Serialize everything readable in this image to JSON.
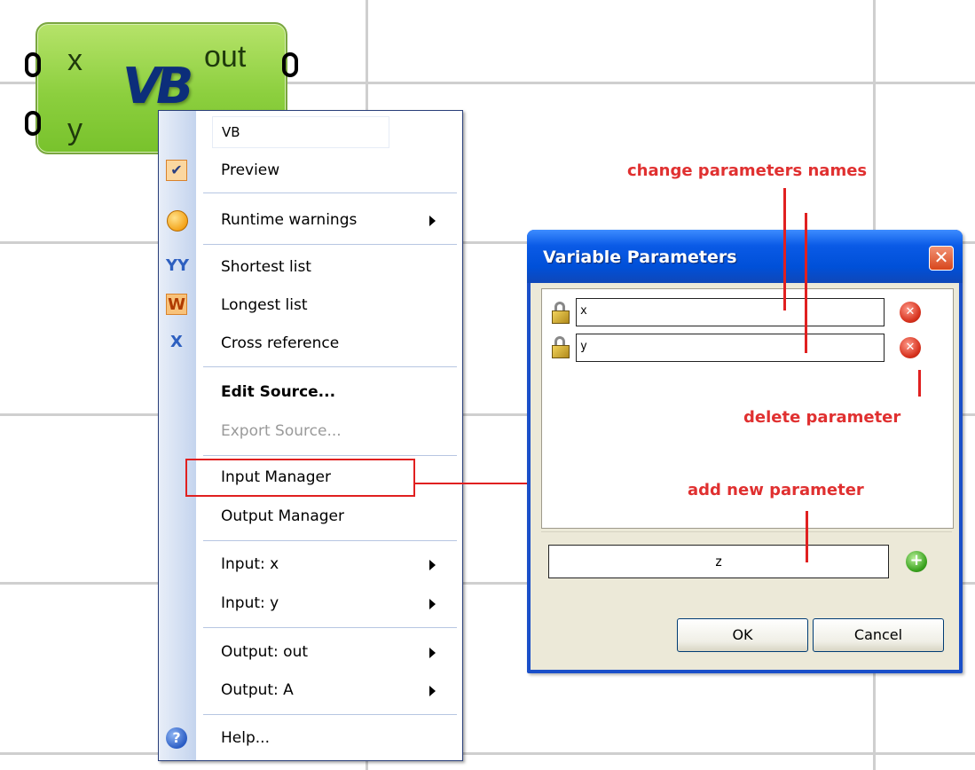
{
  "component": {
    "inputs": [
      "x",
      "y"
    ],
    "output": "out",
    "logo": "VB",
    "color": "#8ccf3e"
  },
  "context_menu": {
    "name_value": "VB",
    "items": {
      "preview": "Preview",
      "runtime_warnings": "Runtime warnings",
      "shortest_list": "Shortest list",
      "longest_list": "Longest list",
      "cross_reference": "Cross reference",
      "edit_source": "Edit Source...",
      "export_source": "Export Source...",
      "input_manager": "Input Manager",
      "output_manager": "Output Manager",
      "input_x": "Input: x",
      "input_y": "Input: y",
      "output_out": "Output: out",
      "output_a": "Output: A",
      "help": "Help..."
    }
  },
  "dialog": {
    "title": "Variable Parameters",
    "close_glyph": "✕",
    "parameters": [
      "x",
      "y"
    ],
    "new_parameter_value": "z",
    "ok_label": "OK",
    "cancel_label": "Cancel"
  },
  "annotations": {
    "change_names": "change parameters names",
    "delete": "delete parameter",
    "add_new": "add new parameter",
    "color": "#e03030"
  },
  "colors": {
    "titlebar_blue": "#0050d8",
    "dialog_bg": "#ece9d8",
    "highlight_red": "#e02020"
  }
}
